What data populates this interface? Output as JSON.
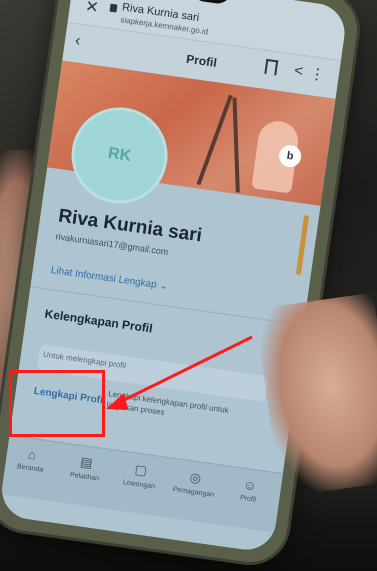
{
  "status": {
    "left": "",
    "right": ""
  },
  "browser": {
    "title": "Riva Kurnia sari",
    "subtitle": "siapkerja.kemnaker.go.id"
  },
  "header": {
    "title": "Profil"
  },
  "profile": {
    "initials": "RK",
    "name": "Riva Kurnia sari",
    "email": "rivakurniasari17@gmail.com",
    "info_link": "Lihat Informasi Lengkap ⌄"
  },
  "completeness": {
    "title": "Kelengkapan Profil",
    "progress_text": "Untuk melengkapi profil",
    "link": "Lengkapi Profil",
    "description": "Lengkapi kelengkapan profil untuk lanjutkan proses"
  },
  "nav": [
    "Beranda",
    "Pelatihan",
    "Lowongan",
    "Pemagangan",
    "Profil"
  ],
  "colors": {
    "annotation": "#ff1a1a",
    "accent": "#2f6fa6",
    "avatar": "#9fd6d5"
  },
  "icons": [
    "close-icon",
    "lock-icon",
    "back-icon",
    "bookmark-icon",
    "share-icon",
    "more-icon",
    "home-icon",
    "training-icon",
    "jobs-icon",
    "internship-icon",
    "profile-icon"
  ]
}
